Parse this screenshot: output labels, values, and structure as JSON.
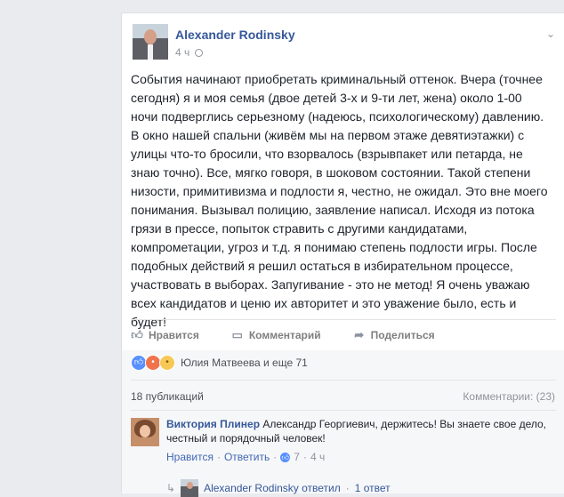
{
  "post": {
    "author": "Alexander Rodinsky",
    "time": "4 ч",
    "text": "События начинают приобретать криминальный оттенок. Вчера (точнее\nсегодня) я и моя семья (двое детей 3-х и 9-ти лет, жена) около 1-00\nночи подверглись серьезному (надеюсь, психологическому) давлению.\nВ окно нашей спальни (живём мы на первом этаже девятиэтажки) с\nулицы что-то бросили, что взорвалось (взрывпакет или петарда, не\nзнаю точно). Все, мягко говоря, в шоковом состоянии. Такой степени\nнизости, примитивизма и подлости я, честно, не ожидал. Это вне моего\nпонимания. Вызывал полицию, заявление написал. Исходя из потока\nгрязи в прессе, попыток стравить с другими кандидатами,\nкомпрометации, угроз и т.д. я понимаю степень подлости игры. После\nподобных действий я решил остаться в избирательном процессе,\nучаствовать в выборах. Запугивание - это не метод! Я очень уважаю\nвсех кандидатов и ценю их авторитет и это уважение было, есть и\nбудет!"
  },
  "actions": {
    "like": "Нравится",
    "comment": "Комментарий",
    "share": "Поделиться"
  },
  "reactions": {
    "text": "Юлия Матвеева и еще 71"
  },
  "stats": {
    "shares": "18 публикаций",
    "comments": "Комментарии: (23)"
  },
  "comment": {
    "author": "Виктория Плинер",
    "text": "Александр Георгиевич, держитесь! Вы знаете свое дело, честный и порядочный человек!",
    "like_link": "Нравится",
    "reply_link": "Ответить",
    "likes": "7",
    "time": "4 ч",
    "dot": "·"
  },
  "reply": {
    "author_text": "Alexander Rodinsky ответил",
    "dot": "·",
    "count": "1 ответ"
  },
  "icons": {
    "like": "thumbs-up-icon",
    "comment": "comment-icon",
    "share": "share-arrow-icon",
    "privacy": "globe-icon",
    "menu": "chevron-down-icon"
  },
  "colors": {
    "link": "#365899",
    "muted": "#90949c",
    "like": "#5890ff",
    "angry": "#f0734b",
    "sad": "#f7c856"
  }
}
